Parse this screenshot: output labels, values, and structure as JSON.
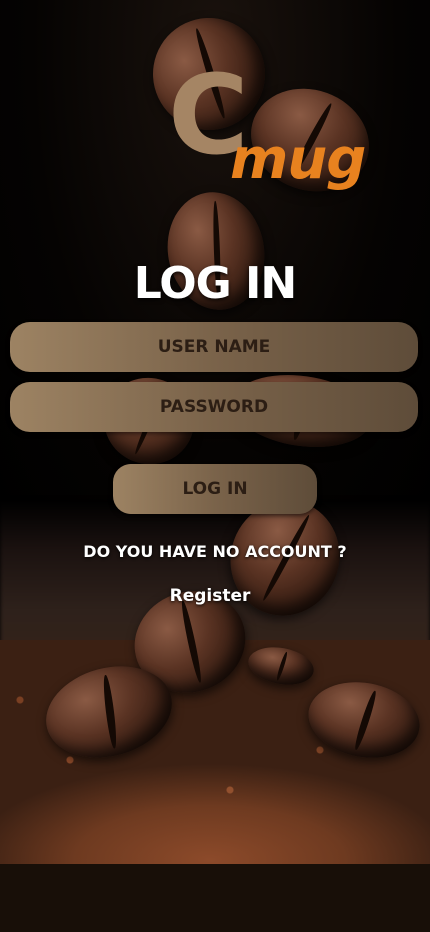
{
  "logo": {
    "letter": "C",
    "word": "mug"
  },
  "title": "LOG IN",
  "form": {
    "username_placeholder": "USER NAME",
    "password_placeholder": "PASSWORD",
    "login_label": "LOG IN"
  },
  "footer": {
    "question": "DO YOU HAVE NO ACCOUNT  ?",
    "register_label": "Register"
  },
  "colors": {
    "logo_c": "#a58564",
    "logo_mug": "#e8821f",
    "field_light": "#9d8363",
    "field_dark": "#5e4c39",
    "field_text": "#2c1e14"
  }
}
